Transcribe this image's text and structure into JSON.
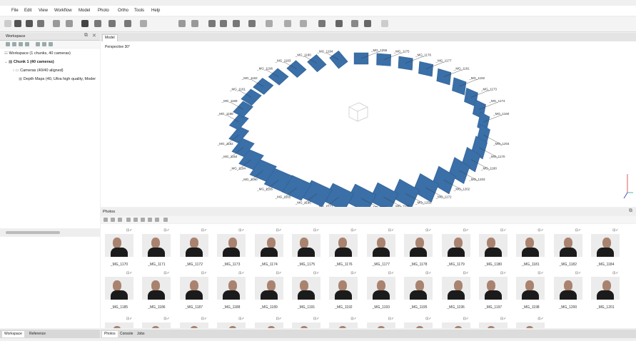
{
  "menu": [
    "File",
    "Edit",
    "View",
    "Workflow",
    "Model",
    "Photo",
    "Ortho",
    "Tools",
    "Help"
  ],
  "left_panel": {
    "title": "Workspace",
    "tree": [
      {
        "label": "Workspace (1 chunks, 40 cameras)"
      },
      {
        "label": "Chunk 1 (40 cameras)"
      },
      {
        "label": "Cameras (40/40 aligned)"
      },
      {
        "label": "Depth Maps (40, Ultra high quality, Moder"
      }
    ],
    "tabs": [
      "Workspace",
      "Reference"
    ]
  },
  "model": {
    "tab": "Model",
    "projection": "Perspective 30°",
    "camera_labels": [
      "_MG_1255",
      "_MG_1175",
      "_MG_1176",
      "_MG_1177",
      "_MG_1191",
      "_MG_1192",
      "_MG_1173",
      "_MG_1174",
      "_MG_1160",
      "_MG_1204",
      "_MG_1170",
      "_MG_1180",
      "_MG_1203",
      "_MG_1202",
      "_MG_1172",
      "_MG_1250",
      "_MG_1180",
      "_MG_1201",
      "_MG_1171",
      "_MG_1196",
      "_MG_1165",
      "_MG_1195",
      "_MG_1190",
      "_MG_1194",
      "_MG_1184",
      "_MG_1182",
      "_MG_1198",
      "_MG_1169",
      "_MG_1161",
      "_MG_1162",
      "_MG_1196",
      "_MG_1183",
      "_MG_1180",
      "_MG_1194",
      "_MG_1181"
    ]
  },
  "photos": {
    "title": "Photos",
    "row1": [
      "_MG_1170",
      "_MG_1171",
      "_MG_1172",
      "_MG_1173",
      "_MG_1174",
      "_MG_1175",
      "_MG_1176",
      "_MG_1177",
      "_MG_1178",
      "_MG_1179",
      "_MG_1180",
      "_MG_1181",
      "_MG_1182",
      "_MG_1184"
    ],
    "row2": [
      "_MG_1185",
      "_MG_1186",
      "_MG_1187",
      "_MG_1188",
      "_MG_1189",
      "_MG_1191",
      "_MG_1192",
      "_MG_1193",
      "_MG_1195",
      "_MG_1196",
      "_MG_1197",
      "_MG_1198",
      "_MG_1200",
      "_MG_1201"
    ],
    "flag": "⊡✓"
  },
  "bottom_tabs": [
    "Photos",
    "Console",
    "Jobs"
  ]
}
